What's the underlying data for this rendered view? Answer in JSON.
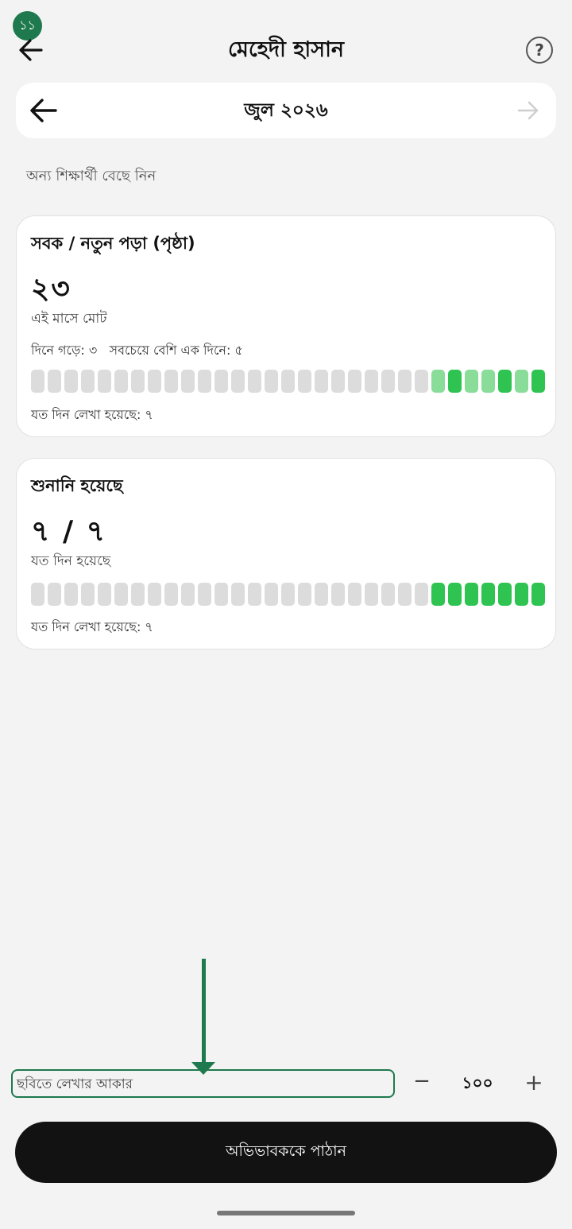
{
  "status": {
    "badge": "১১"
  },
  "header": {
    "title": "মেহেদী হাসান",
    "help_label": "?"
  },
  "month": {
    "label": "জুল ২০২৬"
  },
  "choose_student": "অন্য শিক্ষার্থী বেছে নিন",
  "card_sabak": {
    "title": "সবক / নতুন পড়া (পৃষ্ঠা)",
    "total": "২৩",
    "total_caption": "এই মাসে মোট",
    "stats": "দিনে গড়ে: ৩   সবচেয়ে বেশি এক দিনে: ৫",
    "days_written": "যত দিন লেখা হয়েছে: ৭",
    "day_levels": [
      0,
      0,
      0,
      0,
      0,
      0,
      0,
      0,
      0,
      0,
      0,
      0,
      0,
      0,
      0,
      0,
      0,
      0,
      0,
      0,
      0,
      0,
      0,
      0,
      1,
      2,
      1,
      1,
      2,
      1,
      2
    ]
  },
  "card_shunani": {
    "title": "শুনানি হয়েছে",
    "total": "৭ / ৭",
    "total_caption": "যত দিন হয়েছে",
    "days_written": "যত দিন লেখা হয়েছে: ৭",
    "day_levels": [
      0,
      0,
      0,
      0,
      0,
      0,
      0,
      0,
      0,
      0,
      0,
      0,
      0,
      0,
      0,
      0,
      0,
      0,
      0,
      0,
      0,
      0,
      0,
      0,
      2,
      2,
      2,
      2,
      2,
      2,
      2
    ]
  },
  "text_size": {
    "label": "ছবিতে লেখার আকার",
    "minus": "−",
    "value": "১০০",
    "plus": "+"
  },
  "send_button": "অভিভাবককে পাঠান"
}
